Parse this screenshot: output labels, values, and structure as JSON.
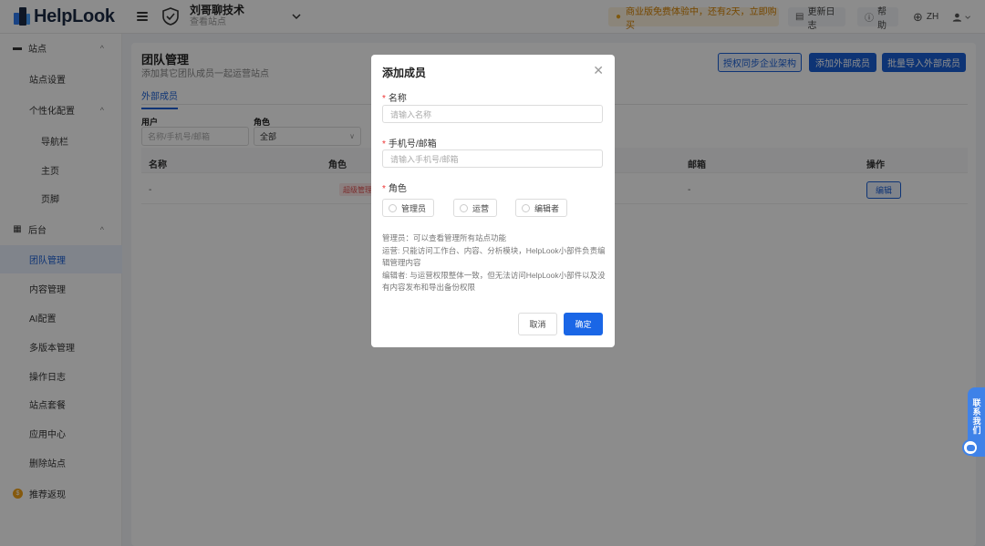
{
  "header": {
    "logo_text": "HelpLook",
    "site_name": "刘哥聊技术",
    "site_sub": "查看站点",
    "trial_text": "商业版免费体验中，还有2天，立即购买",
    "update_log": "更新日志",
    "help": "帮助",
    "lang": "ZH"
  },
  "sidebar": {
    "site_group": "站点",
    "site_settings": "站点设置",
    "personalize": "个性化配置",
    "navbar": "导航栏",
    "home": "主页",
    "footer": "页脚",
    "backend_group": "后台",
    "items": [
      "团队管理",
      "内容管理",
      "AI配置",
      "多版本管理",
      "操作日志",
      "站点套餐",
      "应用中心",
      "删除站点"
    ],
    "referral": "推荐返现"
  },
  "main": {
    "title": "团队管理",
    "desc": "添加其它团队成员一起运营站点",
    "btn_sync": "授权同步企业架构",
    "btn_add_ext": "添加外部成员",
    "btn_import": "批量导入外部成员",
    "tab": "外部成员",
    "filter_user_label": "用户",
    "filter_user_placeholder": "名称/手机号/邮箱",
    "filter_role_label": "角色",
    "filter_role_value": "全部",
    "columns": [
      "名称",
      "角色",
      "邮箱",
      "操作"
    ],
    "row": {
      "name": "-",
      "role": "超级管理员",
      "email": "-",
      "action": "编辑"
    }
  },
  "modal": {
    "title": "添加成员",
    "name_label": "名称",
    "name_placeholder": "请输入名称",
    "contact_label": "手机号/邮箱",
    "contact_placeholder": "请输入手机号/邮箱",
    "role_label": "角色",
    "roles": [
      "管理员",
      "运营",
      "编辑者"
    ],
    "notes": [
      "管理员：可以查看管理所有站点功能",
      "运营: 只能访问工作台、内容、分析模块，HelpLook小部件负责编辑管理内容",
      "编辑者: 与运营权限整体一致，但无法访问HelpLook小部件以及没有内容发布和导出备份权限"
    ],
    "cancel": "取消",
    "ok": "确定"
  },
  "contact_widget": {
    "label": "联系我们"
  },
  "colors": {
    "primary": "#1a5fd6",
    "trial_bg": "#fdf3df",
    "trial_text": "#d68200"
  }
}
